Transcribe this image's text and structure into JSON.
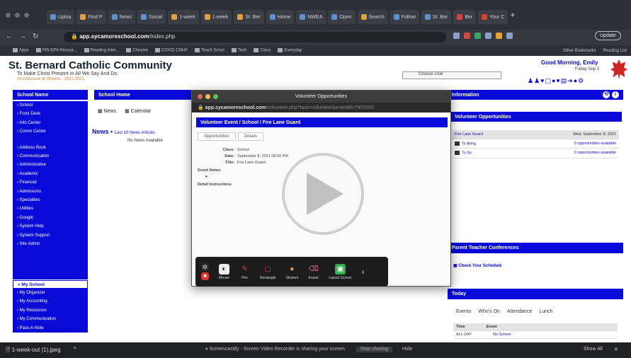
{
  "browser": {
    "tabs": [
      {
        "label": "Uploa",
        "color": "b"
      },
      {
        "label": "Find P",
        "color": "y"
      },
      {
        "label": "News",
        "color": "b"
      },
      {
        "label": "Social",
        "color": "b"
      },
      {
        "label": "1-week",
        "color": "y"
      },
      {
        "label": "1-week",
        "color": "y"
      },
      {
        "label": "St. Ber",
        "color": "y"
      },
      {
        "label": "Home",
        "color": "b"
      },
      {
        "label": "NWEA",
        "color": "b"
      },
      {
        "label": "Open",
        "color": "b"
      },
      {
        "label": "Search",
        "color": "y"
      },
      {
        "label": "Follow",
        "color": "b"
      },
      {
        "label": "St. Ber",
        "color": "b"
      },
      {
        "label": "Ber",
        "color": "r"
      },
      {
        "label": "Your C",
        "color": "r"
      }
    ],
    "new_tab": "+",
    "url_domain": "app.sycamoreschool.com",
    "url_path": "/index.php",
    "update_label": "Update",
    "bookmarks": [
      "Apps",
      "PIN-EPA Resour...",
      "Reading Inter...",
      "Chrome",
      "COVID CNHF",
      "Teach Schol",
      "Tech",
      "Class",
      "Everyday"
    ],
    "other_bookmarks": "Other Bookmarks",
    "reading_list": "Reading List"
  },
  "school": {
    "name": "St. Bernard Catholic Community",
    "motto": "To Make Christ Present In All We Say And Do.",
    "archdiocese": "Archdiocese of Omaha · 2021-2022",
    "chooser": "Choose User",
    "greeting": "Good Morning, Emily",
    "date": "Friday Sep 3",
    "icons": "♟♟♥▢●♥▤➜●⚙"
  },
  "sidebar": {
    "header": "School Name",
    "items": [
      "› School",
      "› Front Desk",
      "› Info Center",
      "› Comm Center",
      "",
      "› Address Book",
      "› Communication",
      "› Administrative",
      "› Academic",
      "› Financial",
      "› Admissions",
      "› Specialties",
      "› Utilities",
      "› Google",
      "› System Help",
      "› System Support",
      "› Site Admin"
    ],
    "my_school": "» My School",
    "my_items": [
      "› My Organizer",
      "› My Accounting",
      "› My Resources",
      "› My Communication",
      "› Pass-A-Note"
    ]
  },
  "main": {
    "header": "School Home",
    "tabs": [
      "News",
      "Calendar"
    ],
    "news_title": "News",
    "news_sub": "Last 10 News Articles",
    "no_news": "No News Available"
  },
  "info": {
    "header": "Information",
    "volunteer_header": "Volunteer Opportunities",
    "vol_rows": [
      {
        "left": "Fire Lane Guard",
        "right": "Wed, September 8, 2021",
        "hdr": true
      },
      {
        "left": "To Bring",
        "right": "0 opportunities available",
        "hdr": false
      },
      {
        "left": "To Do",
        "right": "0 opportunities available",
        "hdr": false
      }
    ],
    "ptc_header": "Parent Teacher Conferences",
    "schedule": "Check Your Schedule",
    "today_header": "Today",
    "today_tabs": [
      "Events",
      "Who's On",
      "Attendance",
      "Lunch"
    ],
    "today_rows": [
      {
        "time": "Time",
        "event": "Event",
        "hdr": true
      },
      {
        "time": "ALL DAY",
        "event": "No School",
        "hdr": false
      }
    ]
  },
  "modal": {
    "title": "Volunteer Opportunities",
    "url_domain": "app.sycamoreschool.com",
    "url_path": "/volunteer.php?task=volunteer&eventid=7903500",
    "crumb": "Volunteer Event / School / Fire Lane Guard",
    "tabs": [
      "Opportunities",
      "Details"
    ],
    "fields": [
      {
        "k": "Class:",
        "v": "School"
      },
      {
        "k": "Date:",
        "v": "September 8, 2021 08:00 PM"
      },
      {
        "k": "Title:",
        "v": "Fire Lane Guard"
      }
    ],
    "event_notes": "Event Notes:",
    "detail_instructions": "Detail Instructions"
  },
  "toolbar": {
    "tools": [
      {
        "label": "Mouse",
        "glyph": "◐",
        "bg": "#eeeeee",
        "fg": "#111111"
      },
      {
        "label": "Pen",
        "glyph": "✎",
        "bg": "#1c1c1c",
        "fg": "#e04040"
      },
      {
        "label": "Rectangle",
        "glyph": "▢",
        "bg": "#1c1c1c",
        "fg": "#e04040"
      },
      {
        "label": "Stickers",
        "glyph": "●",
        "bg": "#1c1c1c",
        "fg": "#f0a030"
      },
      {
        "label": "Eraser",
        "glyph": "⌫",
        "bg": "#1c1c1c",
        "fg": "#e07090"
      },
      {
        "label": "Layout Screen",
        "glyph": "▣",
        "bg": "#2fb24c",
        "fg": "#ffffff"
      }
    ],
    "collapse": "‹"
  },
  "taskbar": {
    "download": "1-week-out (1).jpeg",
    "download_caret": "^",
    "share_text": "Screencastify - Screen Video Recorder is sharing your screen.",
    "stop_sharing": "Stop sharing",
    "hide": "Hide",
    "show_all": "Show All",
    "close": "✕"
  }
}
